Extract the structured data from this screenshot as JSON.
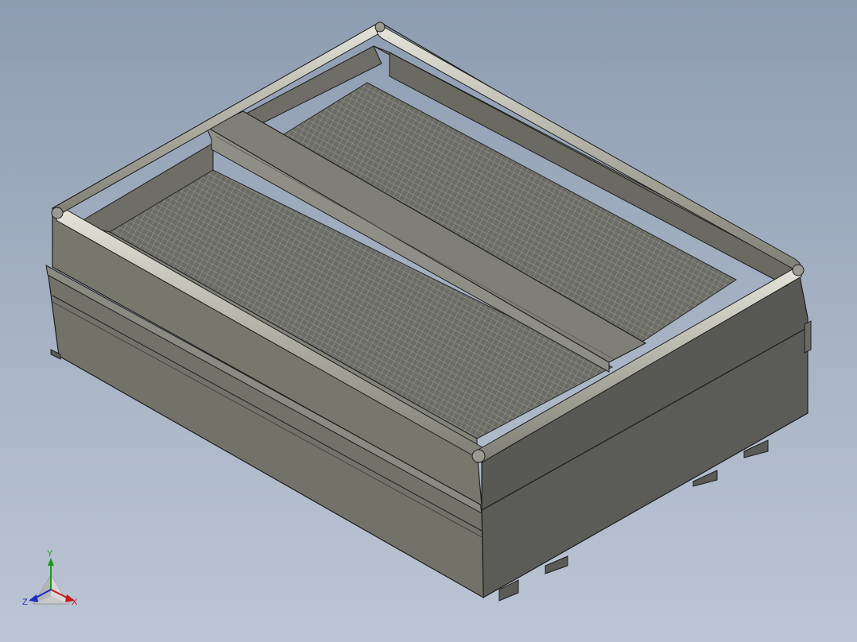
{
  "viewport": {
    "background_top": "#8e9cb2",
    "background_bottom": "#bcc5d4"
  },
  "model": {
    "body_color": "#75756a",
    "dark_face_color": "#595955",
    "edge_color": "#1e1e1e",
    "mesh_color": "#8c8c88",
    "rail_color": "#c8c8bc"
  },
  "triad": {
    "x_label": "X",
    "y_label": "Y",
    "z_label": "Z",
    "x_color": "#c01a1a",
    "y_color": "#1a9a1a",
    "z_color": "#1a2ec0"
  }
}
